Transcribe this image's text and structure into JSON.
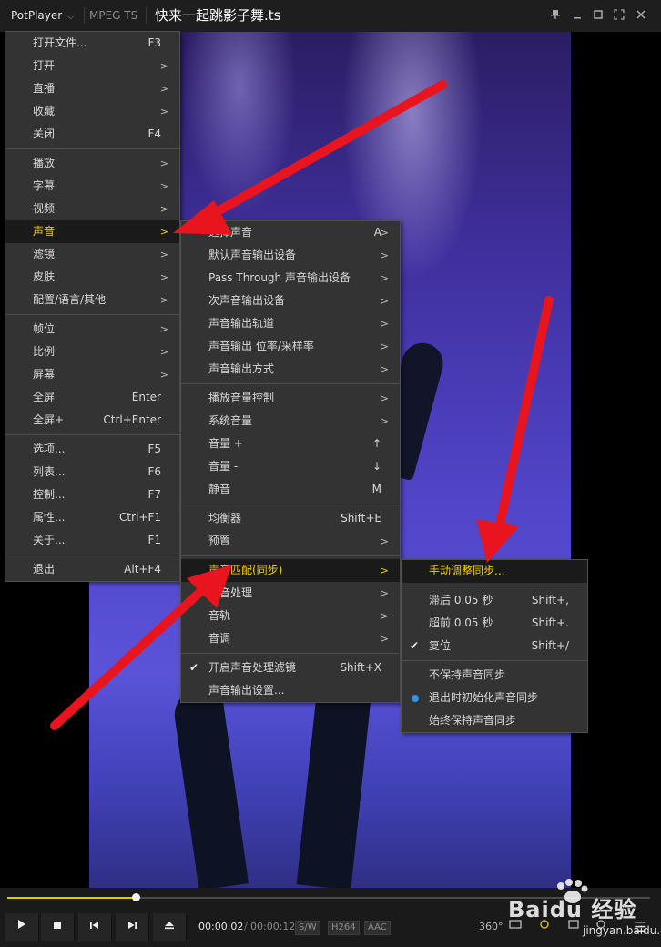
{
  "titlebar": {
    "app_name": "PotPlayer",
    "app_chevron": "⌵",
    "format": "MPEG TS",
    "file_title": "快来一起跳影子舞.ts",
    "buttons": [
      "pin-icon",
      "minimize-icon",
      "restore-icon",
      "fullscreen-icon",
      "close-icon"
    ]
  },
  "main_menu": {
    "items": [
      {
        "label": "打开文件...",
        "shortcut": "F3"
      },
      {
        "label": "打开",
        "arrow": ">"
      },
      {
        "label": "直播",
        "arrow": ">"
      },
      {
        "label": "收藏",
        "arrow": ">"
      },
      {
        "label": "关闭",
        "shortcut": "F4"
      },
      {
        "label": "播放",
        "arrow": ">"
      },
      {
        "label": "字幕",
        "arrow": ">"
      },
      {
        "label": "视频",
        "arrow": ">"
      },
      {
        "label": "声音",
        "arrow": ">"
      },
      {
        "label": "滤镜",
        "arrow": ">"
      },
      {
        "label": "皮肤",
        "arrow": ">"
      },
      {
        "label": "配置/语言/其他",
        "arrow": ">"
      },
      {
        "label": "帧位",
        "arrow": ">"
      },
      {
        "label": "比例",
        "arrow": ">"
      },
      {
        "label": "屏幕",
        "arrow": ">"
      },
      {
        "label": "全屏",
        "shortcut": "Enter"
      },
      {
        "label": "全屏+",
        "shortcut": "Ctrl+Enter"
      },
      {
        "label": "选项...",
        "shortcut": "F5"
      },
      {
        "label": "列表...",
        "shortcut": "F6"
      },
      {
        "label": "控制...",
        "shortcut": "F7"
      },
      {
        "label": "属性...",
        "shortcut": "Ctrl+F1"
      },
      {
        "label": "关于...",
        "shortcut": "F1"
      },
      {
        "label": "退出",
        "shortcut": "Alt+F4"
      }
    ]
  },
  "sound_menu": {
    "items": [
      {
        "label": "选择声音",
        "shortcut": "A",
        "arrow": ">"
      },
      {
        "label": "默认声音输出设备",
        "arrow": ">"
      },
      {
        "label": "Pass Through 声音输出设备",
        "arrow": ">"
      },
      {
        "label": "次声音输出设备",
        "arrow": ">"
      },
      {
        "label": "声音输出轨道",
        "arrow": ">"
      },
      {
        "label": "声音输出 位率/采样率",
        "arrow": ">"
      },
      {
        "label": "声音输出方式",
        "arrow": ">"
      },
      {
        "label": "播放音量控制",
        "arrow": ">"
      },
      {
        "label": "系统音量",
        "arrow": ">"
      },
      {
        "label": "音量 +",
        "shortcut": "↑"
      },
      {
        "label": "音量 -",
        "shortcut": "↓"
      },
      {
        "label": "静音",
        "shortcut": "M"
      },
      {
        "label": "均衡器",
        "shortcut": "Shift+E"
      },
      {
        "label": "预置",
        "arrow": ">"
      },
      {
        "label": "声音匹配(同步)",
        "arrow": ">"
      },
      {
        "label": "声音处理",
        "arrow": ">"
      },
      {
        "label": "音轨",
        "arrow": ">"
      },
      {
        "label": "音调",
        "arrow": ">"
      },
      {
        "label": "开启声音处理滤镜",
        "shortcut": "Shift+X",
        "check": "✔"
      },
      {
        "label": "声音输出设置..."
      }
    ]
  },
  "sync_menu": {
    "items": [
      {
        "label": "手动调整同步..."
      },
      {
        "label": "滞后 0.05 秒",
        "shortcut": "Shift+,"
      },
      {
        "label": "超前 0.05 秒",
        "shortcut": "Shift+."
      },
      {
        "label": "复位",
        "shortcut": "Shift+/",
        "check": "✔"
      },
      {
        "label": "不保持声音同步"
      },
      {
        "label": "退出时初始化声音同步"
      },
      {
        "label": "始终保持声音同步"
      }
    ]
  },
  "controls": {
    "time_current": "00:00:02",
    "time_separator": "/",
    "time_total": "00:00:12",
    "badges": [
      "S/W",
      "H264",
      "AAC"
    ],
    "progress": 0.2,
    "right_icons": [
      "360-icon",
      "3d-icon",
      "capture-icon",
      "settings-icon",
      "playlist-icon",
      "menu-icon"
    ],
    "right_labels": {
      "vr": "360°",
      "menu": "☰"
    }
  },
  "watermark": {
    "text": "Baidu 经验",
    "sub": "jingyan.baidu.com"
  },
  "colors": {
    "highlight": "#f0d000",
    "arrow": "#e8141e",
    "accent": "#3a8ee0",
    "seek": "#e5c400"
  }
}
